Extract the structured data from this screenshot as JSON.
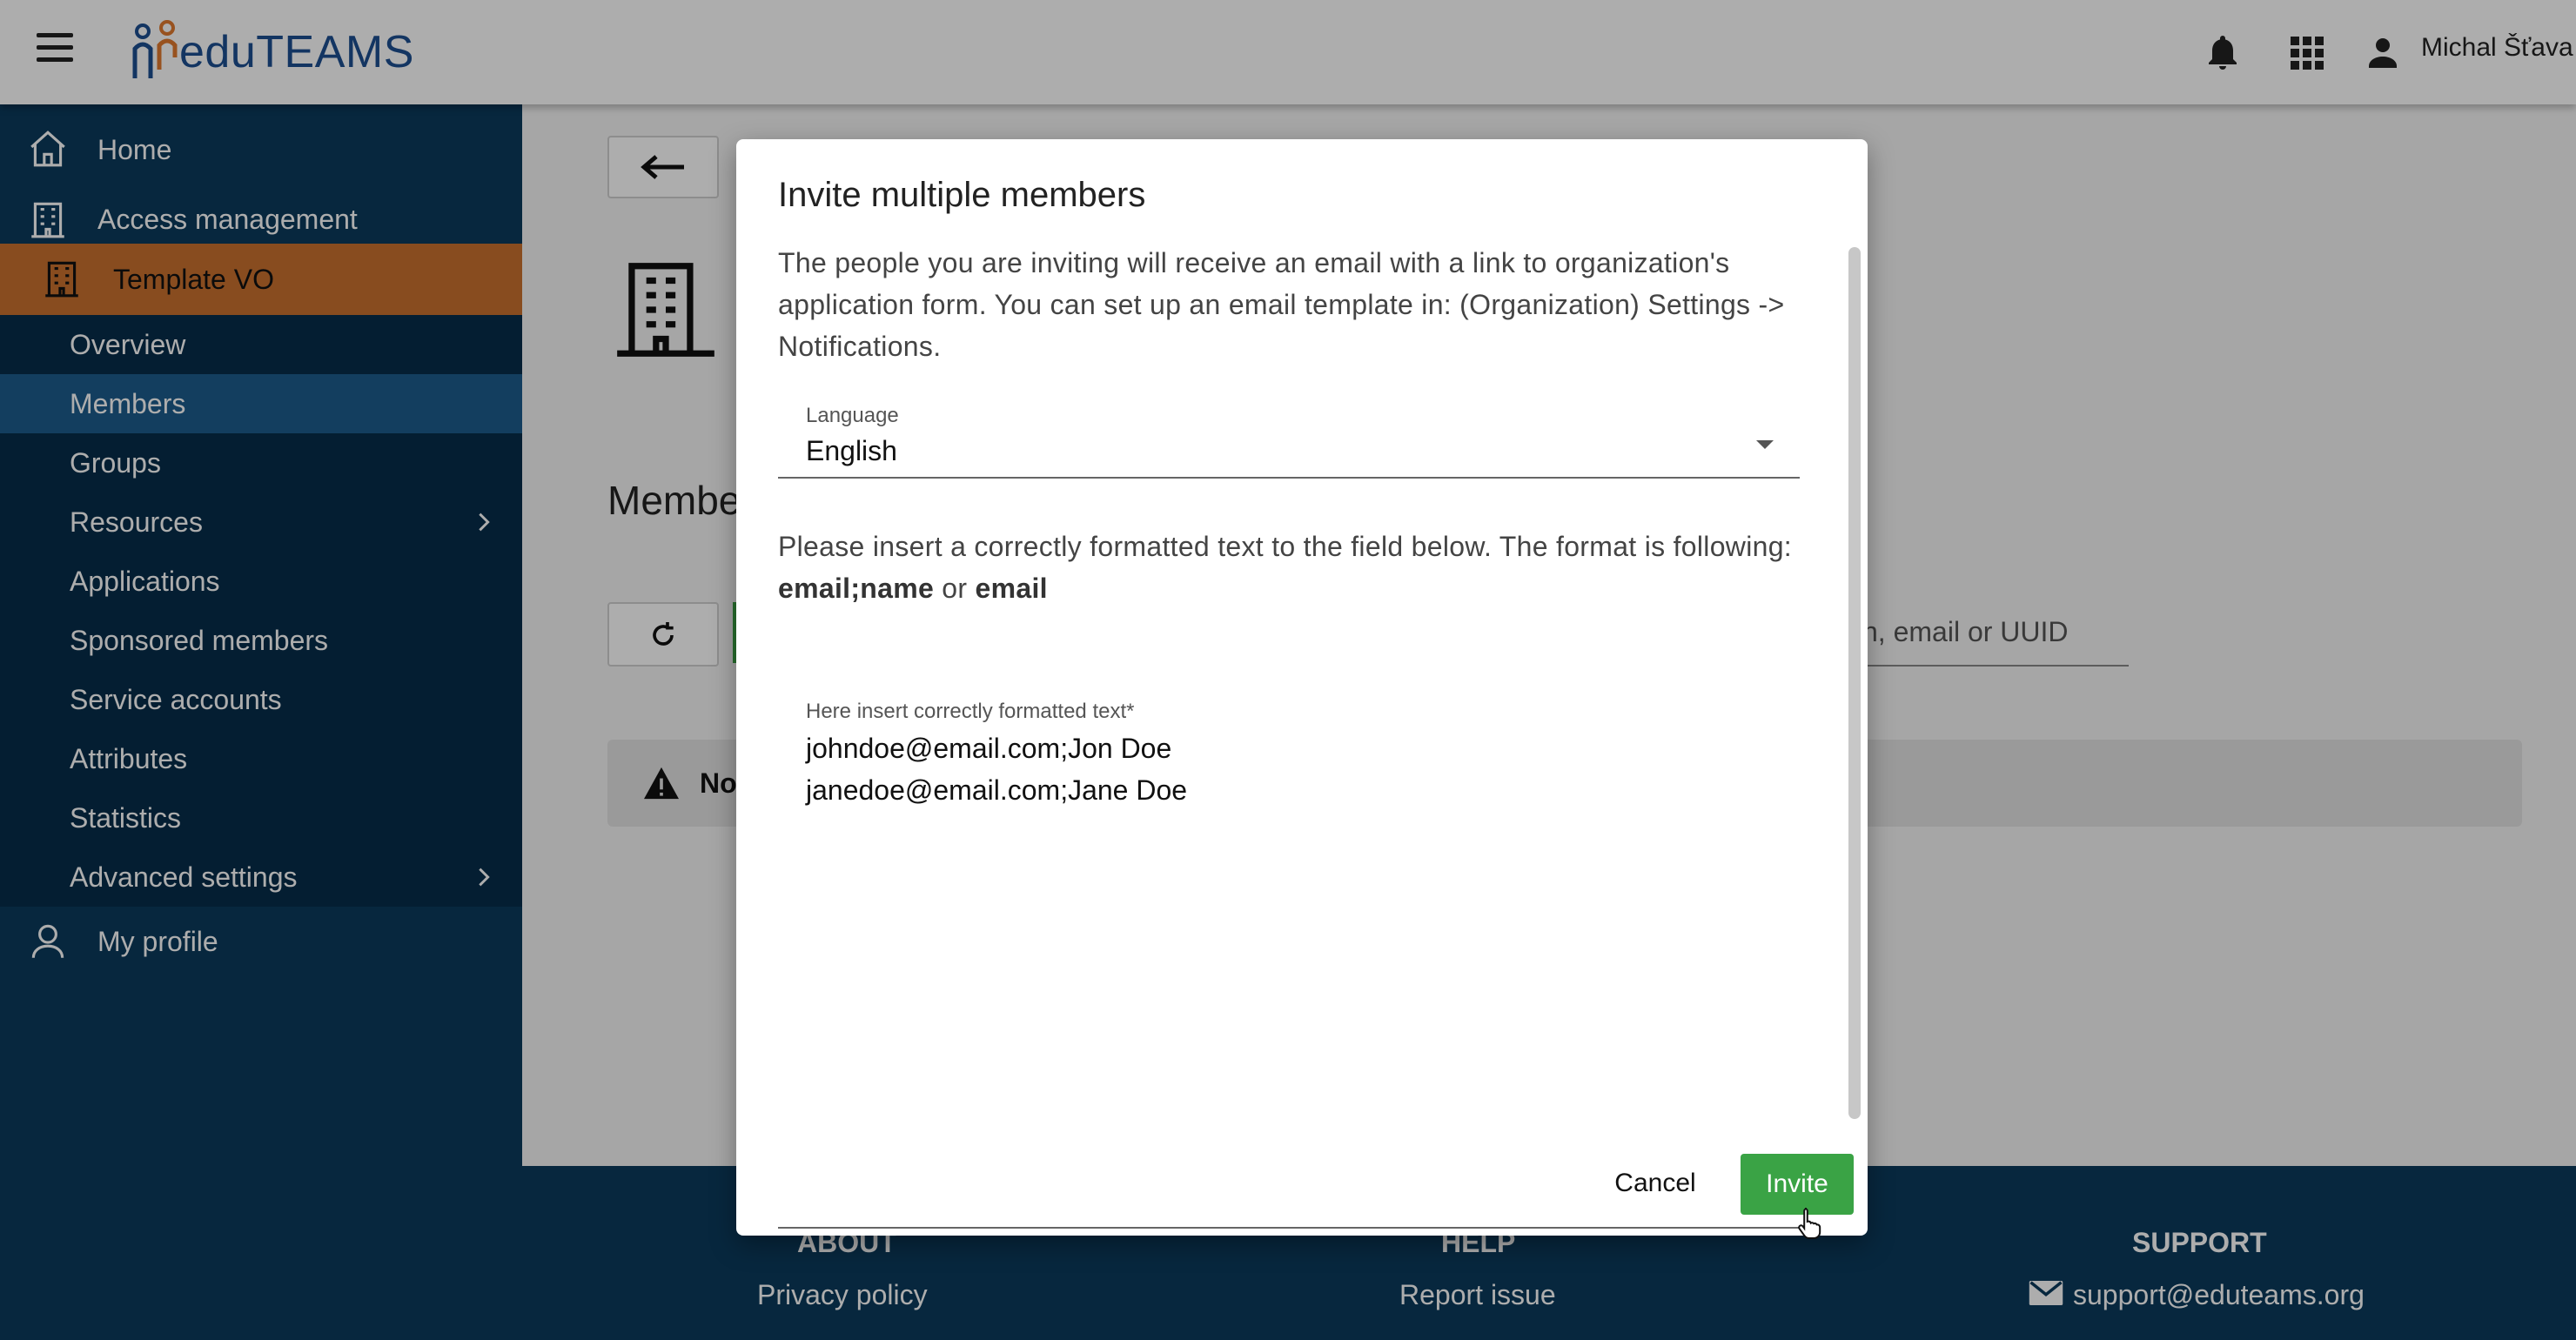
{
  "app": {
    "logo_text": "eduTEAMS"
  },
  "topbar": {
    "user_name": "Michal Šťava",
    "icons": [
      "menu-icon",
      "bell-icon",
      "apps-grid-icon",
      "person-icon"
    ]
  },
  "sidebar": {
    "home": "Home",
    "access_management": "Access management",
    "org": "Template VO",
    "items": [
      {
        "label": "Overview"
      },
      {
        "label": "Members"
      },
      {
        "label": "Groups"
      },
      {
        "label": "Resources"
      },
      {
        "label": "Applications"
      },
      {
        "label": "Sponsored members"
      },
      {
        "label": "Service accounts"
      },
      {
        "label": "Attributes"
      },
      {
        "label": "Statistics"
      },
      {
        "label": "Advanced settings"
      }
    ],
    "my_profile": "My profile",
    "active_color": "#1d5c8c",
    "org_color": "#c9702f"
  },
  "main": {
    "heading_partial": "Membe",
    "search_partial": "n, email or UUID",
    "alert_partial": "No"
  },
  "footer": {
    "about": "ABOUT",
    "privacy": "Privacy policy",
    "help": "HELP",
    "report": "Report issue",
    "support": "SUPPORT",
    "support_email": "support@eduteams.org"
  },
  "dialog": {
    "title": "Invite multiple members",
    "intro": "The people you are inviting will receive an email with a link to organization's application form. You can set up an email template in: (Organization) Settings -> Notifications.",
    "language_label": "Language",
    "language_value": "English",
    "format_text": "Please insert a correctly formatted text to the field below. The format is following:",
    "format_bold1": "email;name",
    "format_or": "or",
    "format_bold2": "email",
    "textarea_label": "Here insert correctly formatted text*",
    "textarea_value": "johndoe@email.com;Jon Doe\njanedoe@email.com;Jane Doe",
    "cancel": "Cancel",
    "invite": "Invite",
    "invite_color": "#3aa345"
  }
}
